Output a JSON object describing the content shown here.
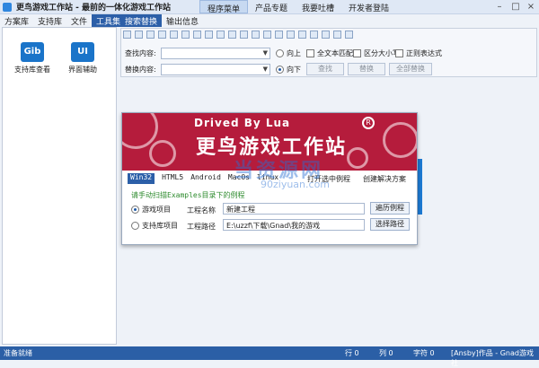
{
  "window": {
    "title": "更鸟游戏工作站 - 最前的一体化游戏工作站"
  },
  "menubar": [
    "程序菜单",
    "产品专题",
    "我要吐槽",
    "开发者登陆"
  ],
  "left_tabs": [
    "方案库",
    "支持库",
    "文件",
    "工具集"
  ],
  "tools": [
    {
      "icon_text": "Gib",
      "label": "支持库查看"
    },
    {
      "icon_text": "UI",
      "label": "界面辅助"
    }
  ],
  "right_tabs": [
    "搜索替换",
    "输出信息"
  ],
  "search": {
    "find_label": "查找内容:",
    "replace_label": "替换内容:",
    "find_value": "",
    "replace_value": "",
    "radio_up": "向上",
    "radio_down": "向下",
    "chk_fulltext": "全文本匹配",
    "chk_case": "区分大小写",
    "chk_regex": "正则表达式",
    "btn_find": "查找",
    "btn_replace": "替换",
    "btn_replace_all": "全部替换"
  },
  "dialog": {
    "banner_sub": "Drived By Lua",
    "banner_title": "更鸟游戏工作站",
    "banner_logo": "R",
    "tabs": [
      "Win32",
      "HTML5",
      "Android",
      "MacOs",
      "linux"
    ],
    "link_open": "打开选中例程",
    "link_create": "创建解决方案",
    "hint_pre": "请手动扫描",
    "hint_mono": "Examples",
    "hint_post": "目录下的例程",
    "radio_game": "游戏项目",
    "radio_lib": "支持库项目",
    "name_label": "工程名称",
    "path_label": "工程路径",
    "name_value": "新建工程",
    "path_value": "E:\\uzzf\\下载\\Gnad\\我的游戏",
    "btn_browse": "遍历例程",
    "btn_choose": "选择路径"
  },
  "watermark": {
    "main": "当资源网",
    "sub": "90ziyuan.com"
  },
  "status": {
    "left": "准备就绪",
    "row": "行 0",
    "col": "列 0",
    "chars": "字符 0",
    "credit": "[Ansby]作品 - Gnad游戏社"
  }
}
